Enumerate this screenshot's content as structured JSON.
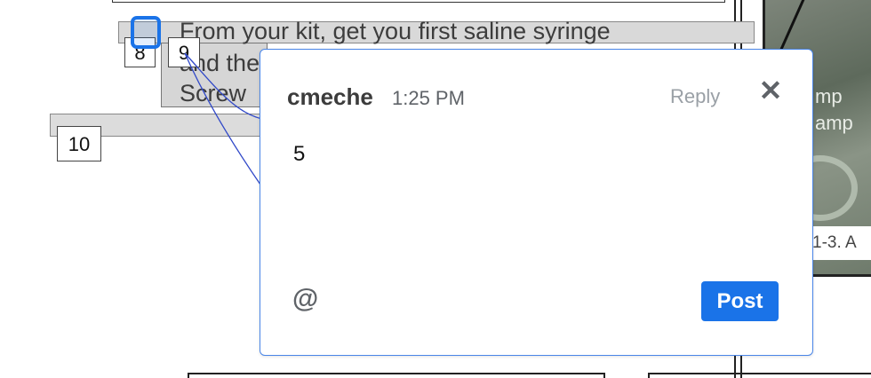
{
  "document": {
    "instruction_line1": "From your kit, get you first saline syringe",
    "instruction_line2": "and the",
    "instruction_line3": "Screw",
    "step_markers": [
      "8",
      "9",
      "10"
    ],
    "photo_overlay_line1": "mp",
    "photo_overlay_line2": "amp",
    "figure_caption": "1-3.  A"
  },
  "comment": {
    "author": "cmeche",
    "time": "1:25 PM",
    "reply_label": "Reply",
    "close_icon": "✕",
    "body": "5",
    "mention_icon": "@",
    "post_label": "Post"
  },
  "colors": {
    "accent": "#1a73e8",
    "popup_border": "#4a86e8",
    "connector": "#3048c8"
  }
}
